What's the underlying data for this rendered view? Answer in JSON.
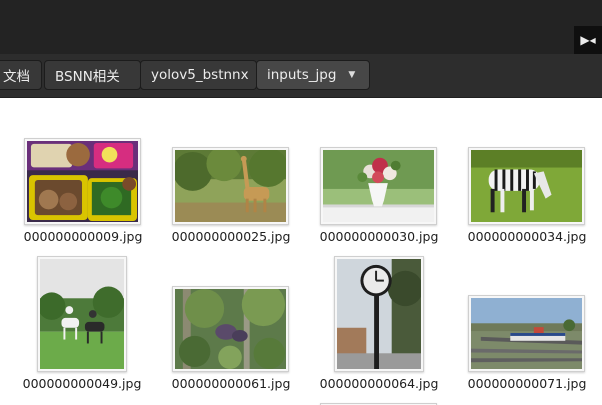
{
  "window": {
    "corner_button_glyph": "▶◂"
  },
  "breadcrumbs": [
    {
      "label": "文档"
    },
    {
      "label": "BSNN相关"
    },
    {
      "label": "yolov5_bstnnx"
    },
    {
      "label": "inputs_jpg",
      "dropdown_glyph": "▼"
    }
  ],
  "files": [
    {
      "name": "000000000009.jpg",
      "subject": "lunch-box"
    },
    {
      "name": "000000000025.jpg",
      "subject": "giraffe"
    },
    {
      "name": "000000000030.jpg",
      "subject": "flower-vase"
    },
    {
      "name": "000000000034.jpg",
      "subject": "zebra"
    },
    {
      "name": "000000000049.jpg",
      "subject": "horses"
    },
    {
      "name": "000000000061.jpg",
      "subject": "elephants-in-jungle"
    },
    {
      "name": "000000000064.jpg",
      "subject": "street-clock"
    },
    {
      "name": "000000000071.jpg",
      "subject": "train-yard"
    }
  ],
  "colors": {
    "titlebar": "#232323",
    "pathbar": "#2d2d2d",
    "crumb": "#383838",
    "crumb_active": "#474747",
    "crumb_text": "#ececec",
    "content_bg": "#ffffff",
    "filename_text": "#202020"
  }
}
